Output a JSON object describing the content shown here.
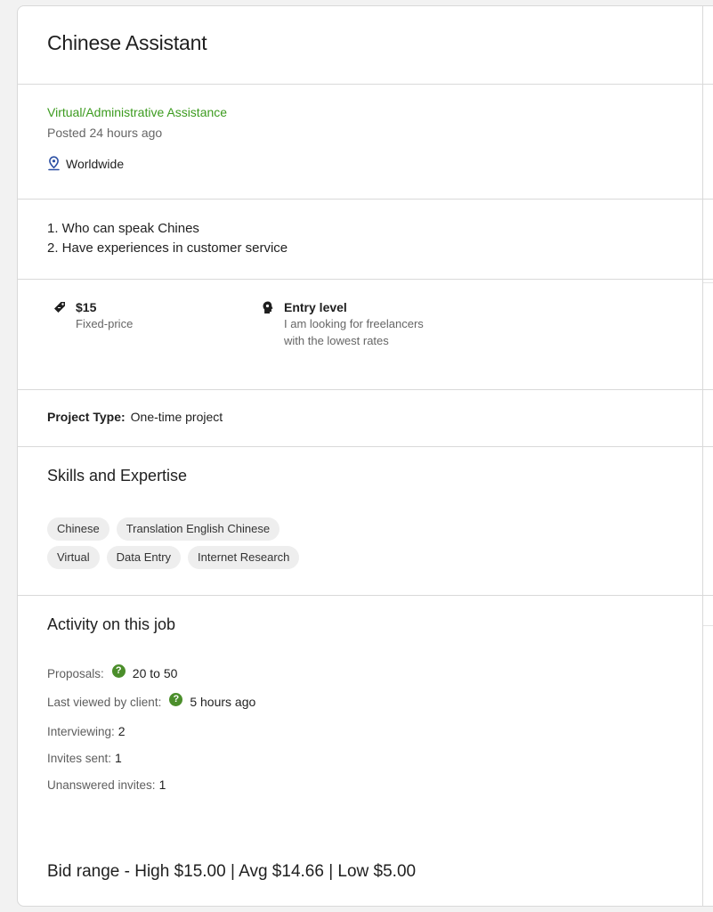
{
  "job": {
    "title": "Chinese Assistant",
    "category": "Virtual/Administrative Assistance",
    "posted": "Posted 24 hours ago",
    "location": "Worldwide",
    "description": [
      "1. Who can speak Chines",
      "2. Have experiences in customer service"
    ]
  },
  "features": {
    "price": {
      "title": "$15",
      "sub": "Fixed-price",
      "icon": "price-tag-icon"
    },
    "level": {
      "title": "Entry level",
      "sub_line1": "I am looking for freelancers",
      "sub_line2": "with the lowest rates",
      "icon": "expertise-level-icon"
    }
  },
  "project_type": {
    "label": "Project Type:",
    "value": "One-time project"
  },
  "skills": {
    "heading": "Skills and Expertise",
    "row1": [
      "Chinese",
      "Translation English Chinese"
    ],
    "row2": [
      "Virtual",
      "Data Entry",
      "Internet Research"
    ]
  },
  "activity": {
    "heading": "Activity on this job",
    "proposals_label": "Proposals:",
    "proposals_value": "20 to 50",
    "last_viewed_label": "Last viewed by client:",
    "last_viewed_value": "5 hours ago",
    "interviewing_label": "Interviewing:",
    "interviewing_value": "2",
    "invites_label": "Invites sent:",
    "invites_value": "1",
    "unanswered_label": "Unanswered invites:",
    "unanswered_value": "1",
    "help_glyph": "?"
  },
  "bid_range": "Bid range - High $15.00 | Avg $14.66 | Low $5.00",
  "colors": {
    "accent_green": "#3c9b1f",
    "help_green": "#4b8e2b",
    "location_blue": "#2b4fa3"
  }
}
